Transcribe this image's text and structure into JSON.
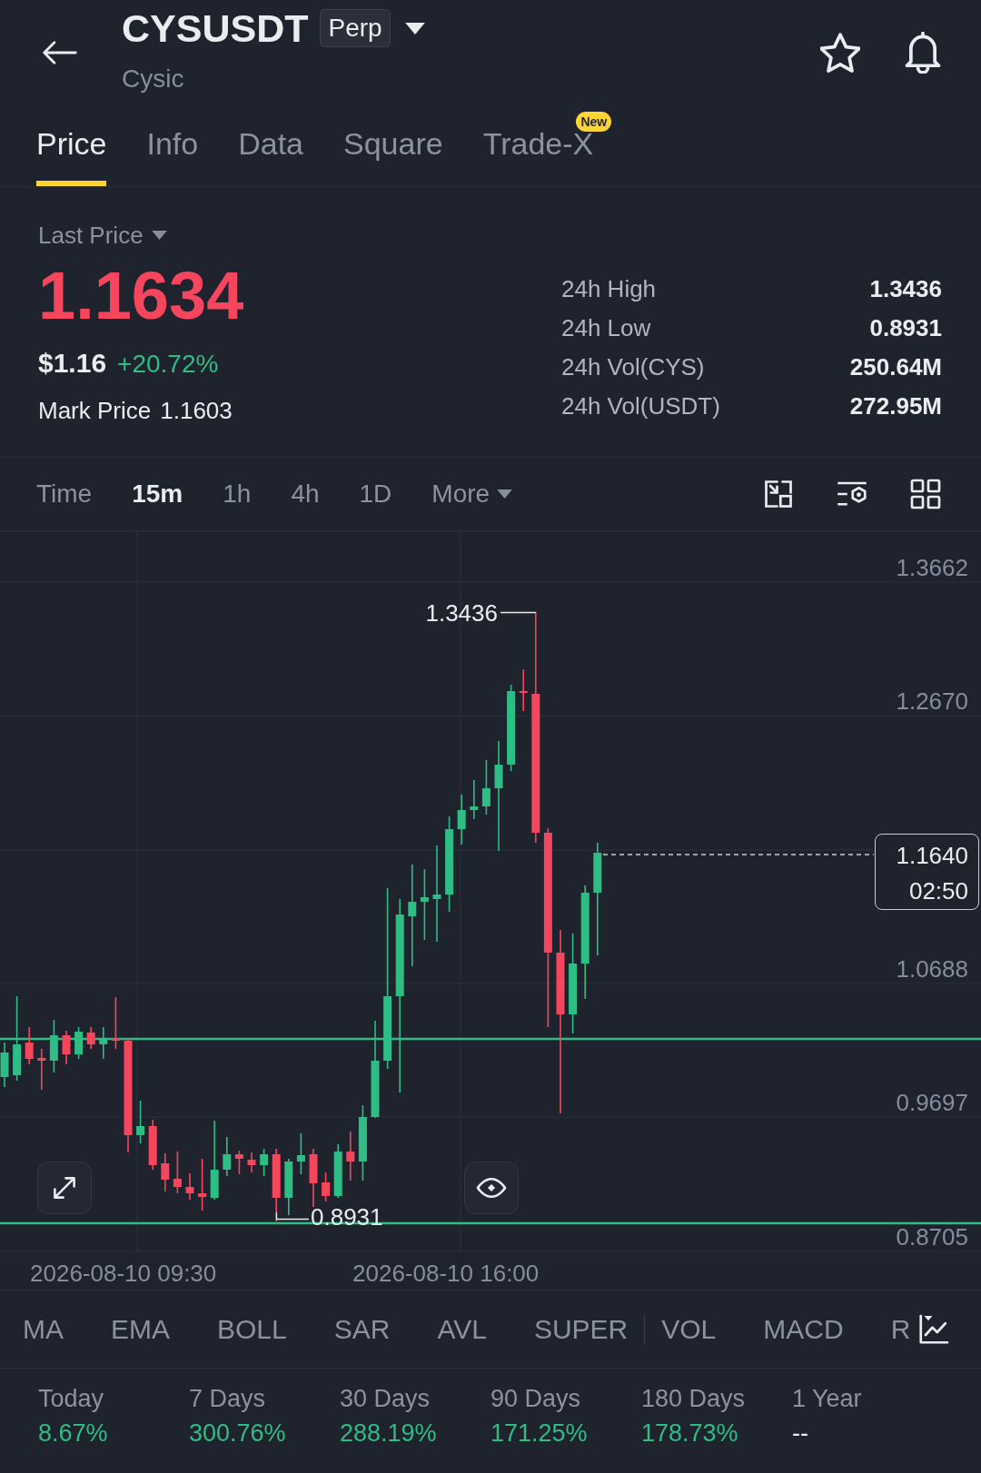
{
  "header": {
    "symbol": "CYSUSDT",
    "contract_badge": "Perp",
    "name": "Cysic"
  },
  "tabs": [
    {
      "label": "Price",
      "selected": true
    },
    {
      "label": "Info",
      "selected": false
    },
    {
      "label": "Data",
      "selected": false
    },
    {
      "label": "Square",
      "selected": false
    },
    {
      "label": "Trade-X",
      "selected": false,
      "badge": "New"
    }
  ],
  "price_panel": {
    "price_type": "Last Price",
    "last_price": "1.1634",
    "rising": false,
    "usd_price": "$1.16",
    "change": "+20.72%",
    "mark_price_label": "Mark Price",
    "mark_price": "1.1603",
    "stats": [
      {
        "label": "24h High",
        "value": "1.3436"
      },
      {
        "label": "24h Low",
        "value": "0.8931"
      },
      {
        "label": "24h Vol(CYS)",
        "value": "250.64M"
      },
      {
        "label": "24h Vol(USDT)",
        "value": "272.95M"
      }
    ]
  },
  "intervals": [
    {
      "label": "Time",
      "kind": "option",
      "selected": false
    },
    {
      "label": "15m",
      "kind": "option",
      "selected": true
    },
    {
      "label": "1h",
      "kind": "option",
      "selected": false
    },
    {
      "label": "4h",
      "kind": "option",
      "selected": false
    },
    {
      "label": "1D",
      "kind": "option",
      "selected": false
    },
    {
      "label": "More",
      "kind": "menu",
      "selected": false
    }
  ],
  "chart": {
    "y_axis_labels": [
      "1.3662",
      "1.2670",
      "1.0688",
      "0.9697",
      "0.8705"
    ],
    "x_axis_labels": [
      "2026-08-10 09:30",
      "2026-08-10 16:00"
    ],
    "high_marker": "1.3436",
    "low_marker": "0.8931",
    "current_price": "1.1640",
    "countdown": "02:50"
  },
  "indicators": {
    "main": [
      "MA",
      "EMA",
      "BOLL",
      "SAR",
      "AVL",
      "SUPER"
    ],
    "sub": [
      "VOL",
      "MACD",
      "R"
    ]
  },
  "returns": [
    {
      "period": "Today",
      "value": "8.67%",
      "positive": true
    },
    {
      "period": "7 Days",
      "value": "300.76%",
      "positive": true
    },
    {
      "period": "30 Days",
      "value": "288.19%",
      "positive": true
    },
    {
      "period": "90 Days",
      "value": "171.25%",
      "positive": true
    },
    {
      "period": "180 Days",
      "value": "178.73%",
      "positive": true
    },
    {
      "period": "1 Year",
      "value": "--",
      "positive": false
    }
  ]
}
